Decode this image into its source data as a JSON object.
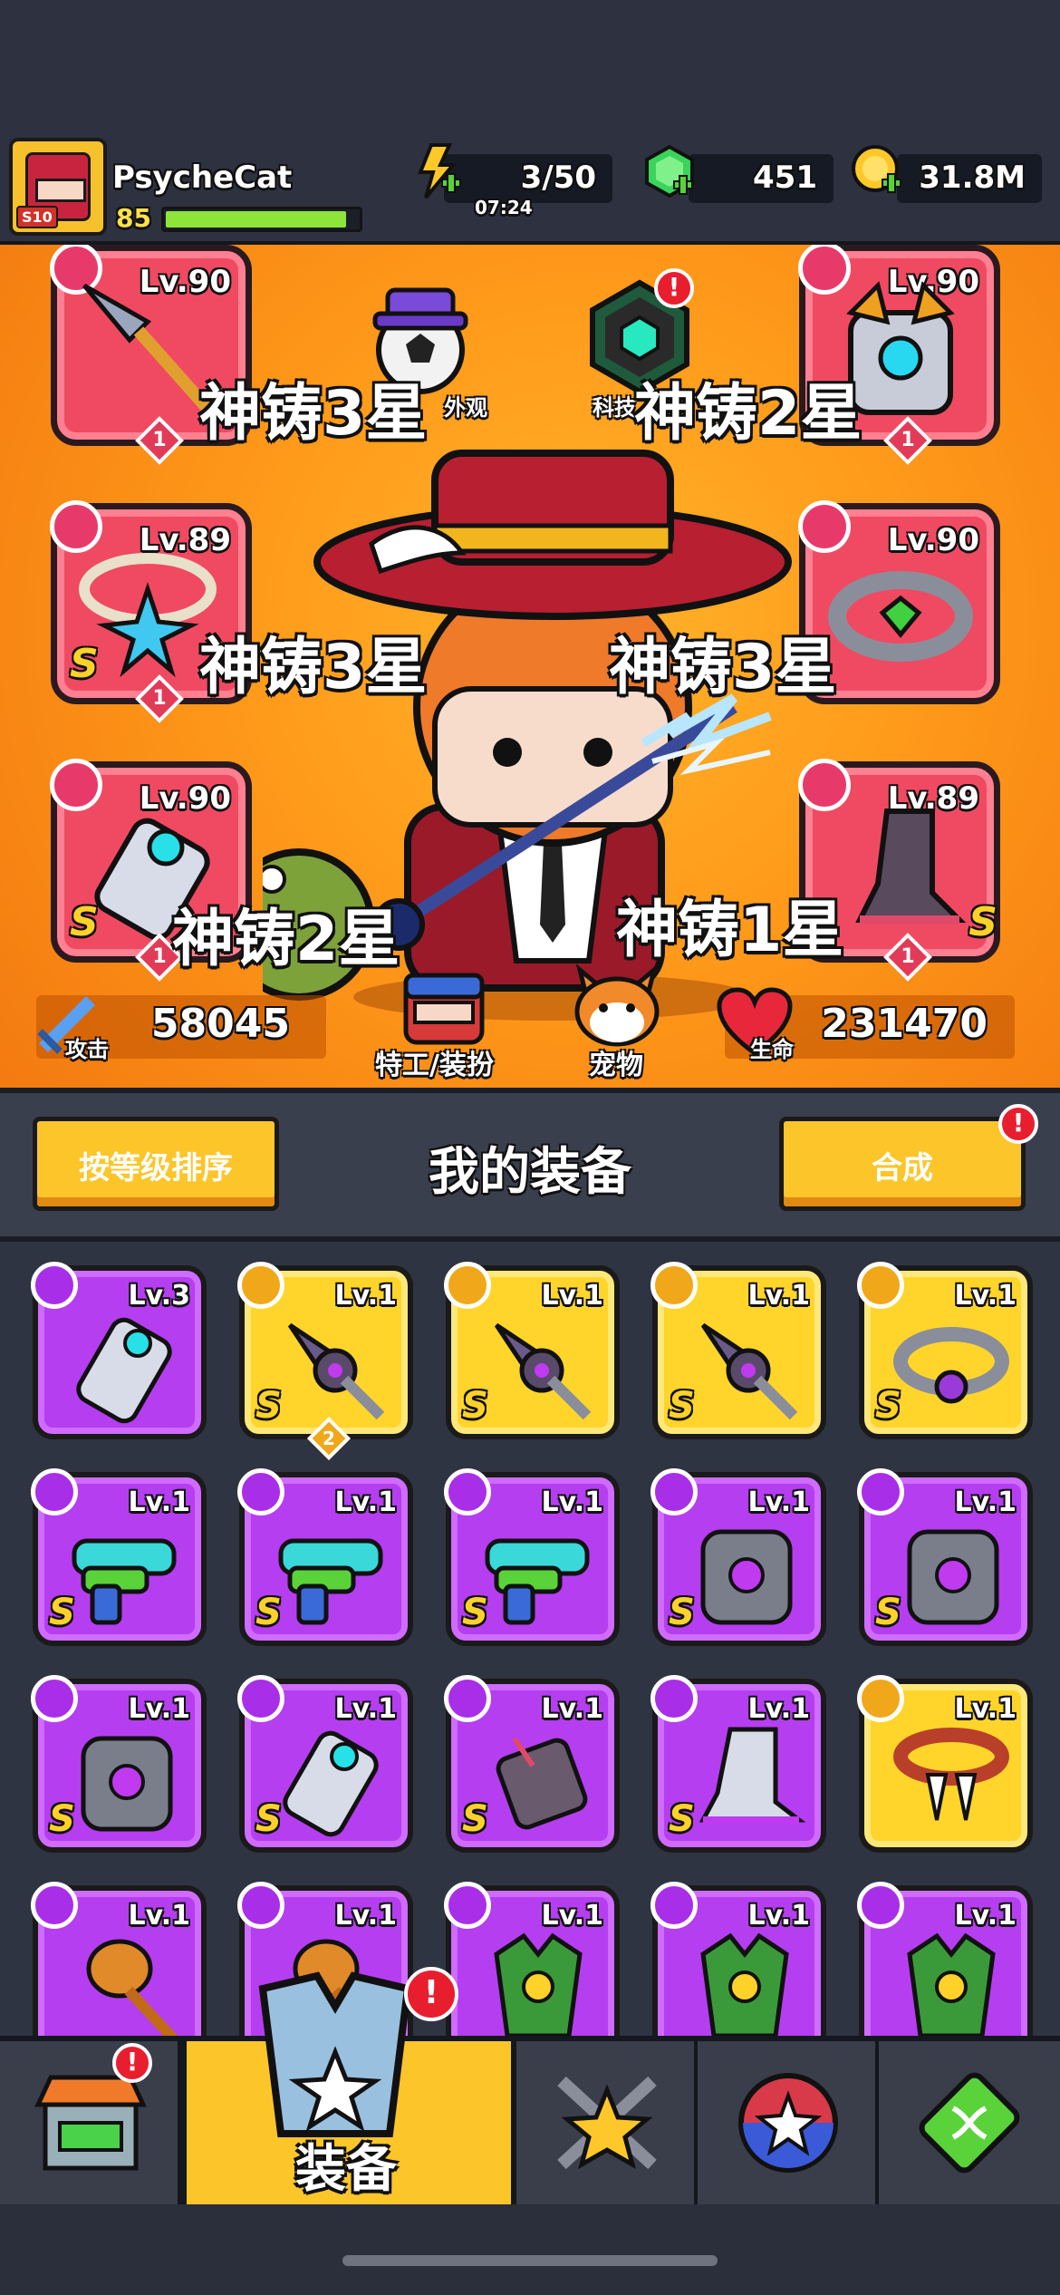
{
  "player": {
    "name": "PsycheCat",
    "level": "85",
    "vip": "S10",
    "xp_fraction": 0.94
  },
  "resources": {
    "energy": "3/50",
    "energy_timer": "07:24",
    "gems": "451",
    "gold": "31.8M"
  },
  "arena": {
    "tech_label": "科技",
    "skin_label": "外观",
    "slots": [
      {
        "level": "Lv.90",
        "stars": "1",
        "forge": "神铸3星",
        "grade": ""
      },
      {
        "level": "Lv.89",
        "stars": "1",
        "forge": "神铸3星",
        "grade": "S"
      },
      {
        "level": "Lv.90",
        "stars": "1",
        "forge": "神铸2星",
        "grade": "S"
      },
      {
        "level": "Lv.90",
        "stars": "1",
        "forge": "神铸2星",
        "grade": ""
      },
      {
        "level": "Lv.90",
        "stars": "",
        "forge": "神铸3星",
        "grade": ""
      },
      {
        "level": "Lv.89",
        "stars": "1",
        "forge": "神铸1星",
        "grade": "S"
      }
    ],
    "attack_label": "攻击",
    "attack_value": "58045",
    "hp_label": "生命",
    "hp_value": "231470",
    "agent_label": "特工/装扮",
    "pet_label": "宠物"
  },
  "section": {
    "sort_button": "按等级排序",
    "title": "我的装备",
    "merge_button": "合成"
  },
  "inventory": [
    {
      "level": "Lv.3",
      "rarity": "purple",
      "grade": "",
      "icon": "gauntlet-icon"
    },
    {
      "level": "Lv.1",
      "rarity": "gold",
      "grade": "S",
      "icon": "spear-icon",
      "qty": "2"
    },
    {
      "level": "Lv.1",
      "rarity": "gold",
      "grade": "S",
      "icon": "spear-icon"
    },
    {
      "level": "Lv.1",
      "rarity": "gold",
      "grade": "S",
      "icon": "spear-icon"
    },
    {
      "level": "Lv.1",
      "rarity": "gold",
      "grade": "S",
      "icon": "ring-icon"
    },
    {
      "level": "Lv.1",
      "rarity": "purple",
      "grade": "S",
      "icon": "water-gun-icon"
    },
    {
      "level": "Lv.1",
      "rarity": "purple",
      "grade": "S",
      "icon": "water-gun-icon"
    },
    {
      "level": "Lv.1",
      "rarity": "purple",
      "grade": "S",
      "icon": "water-gun-icon"
    },
    {
      "level": "Lv.1",
      "rarity": "purple",
      "grade": "S",
      "icon": "armor-icon"
    },
    {
      "level": "Lv.1",
      "rarity": "purple",
      "grade": "S",
      "icon": "armor-icon"
    },
    {
      "level": "Lv.1",
      "rarity": "purple",
      "grade": "S",
      "icon": "armor-icon"
    },
    {
      "level": "Lv.1",
      "rarity": "purple",
      "grade": "S",
      "icon": "gauntlet-icon"
    },
    {
      "level": "Lv.1",
      "rarity": "purple",
      "grade": "S",
      "icon": "claw-glove-icon"
    },
    {
      "level": "Lv.1",
      "rarity": "purple",
      "grade": "S",
      "icon": "boot-icon"
    },
    {
      "level": "Lv.1",
      "rarity": "gold",
      "grade": "",
      "icon": "fang-necklace-icon"
    },
    {
      "level": "Lv.1",
      "rarity": "purple",
      "grade": "",
      "icon": "hammer-icon"
    },
    {
      "level": "Lv.1",
      "rarity": "purple",
      "grade": "",
      "icon": "hammer-icon"
    },
    {
      "level": "Lv.1",
      "rarity": "purple",
      "grade": "",
      "icon": "dragon-armor-icon"
    },
    {
      "level": "Lv.1",
      "rarity": "purple",
      "grade": "",
      "icon": "dragon-armor-icon"
    },
    {
      "level": "Lv.1",
      "rarity": "purple",
      "grade": "",
      "icon": "dragon-armor-icon"
    }
  ],
  "nav": {
    "equip_label": "装备"
  },
  "colors": {
    "purple": "#b53ef0",
    "gold": "#ffd52b",
    "slot_red": "#f04a62",
    "arena_orange": "#ff9a1a"
  }
}
